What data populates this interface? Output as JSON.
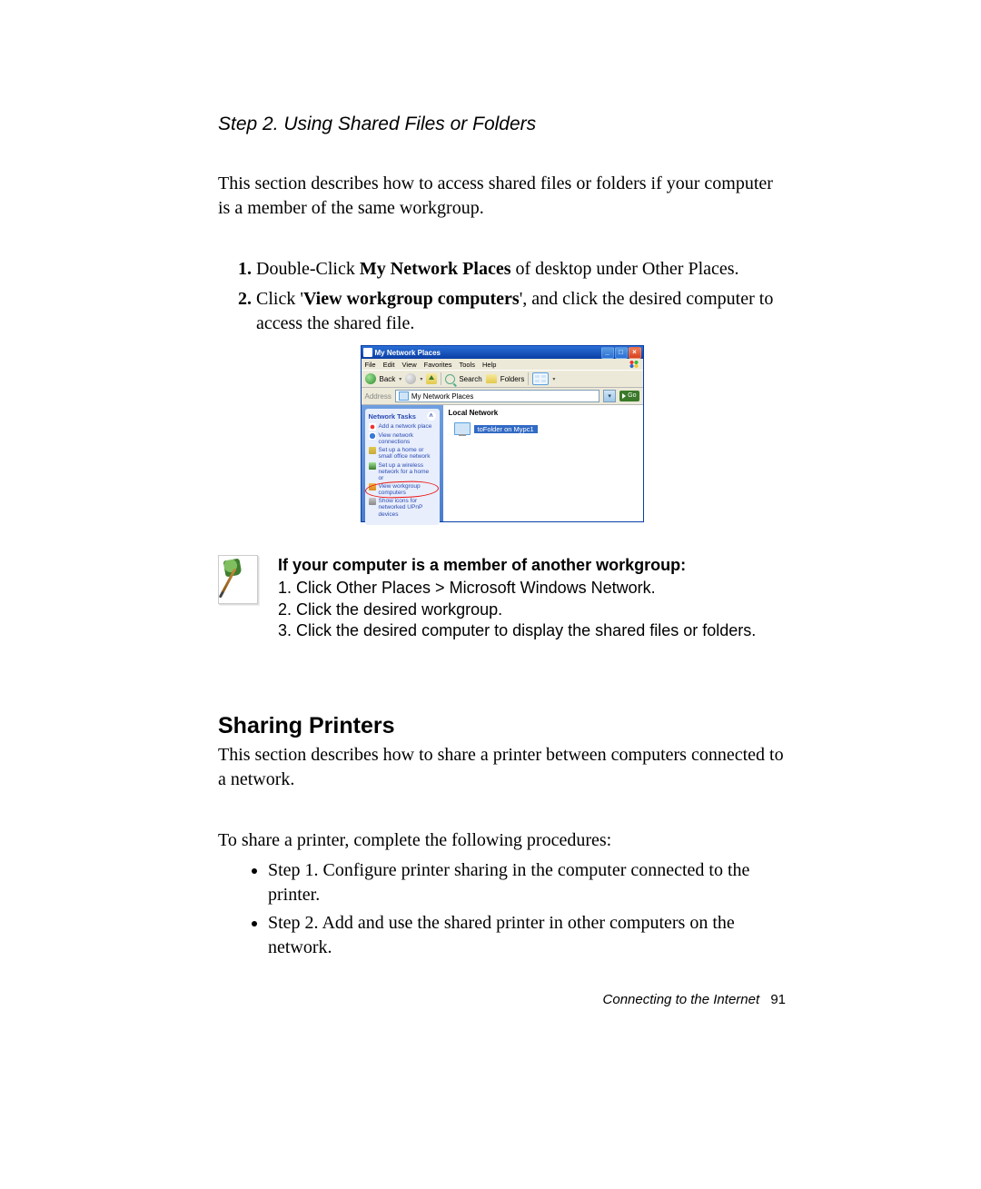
{
  "step_title": "Step 2. Using Shared Files or Folders",
  "intro": "This section describes how to access shared files or folders if your computer is a member of the same workgroup.",
  "steps": {
    "s1_a": "Double-Click ",
    "s1_b": "My Network Places",
    "s1_c": " of desktop under Other Places.",
    "s2_a": "Click '",
    "s2_b": "View workgroup computers",
    "s2_c": "', and click the desired computer to access the shared file."
  },
  "xp": {
    "title": "My Network Places",
    "menus": [
      "File",
      "Edit",
      "View",
      "Favorites",
      "Tools",
      "Help"
    ],
    "toolbar": {
      "back": "Back",
      "search": "Search",
      "folders": "Folders"
    },
    "addr_label": "Address",
    "addr_value": "My Network Places",
    "go": "Go",
    "tasks_header": "Network Tasks",
    "tasks": [
      "Add a network place",
      "View network connections",
      "Set up a home or small office network",
      "Set up a wireless network for a home or",
      "View workgroup computers",
      "Show icons for networked UPnP devices"
    ],
    "main_header": "Local Network",
    "item_label": "toFolder on Mypc1"
  },
  "note": {
    "title": "If your computer is a member of another workgroup:",
    "l1": "1. Click Other Places > Microsoft Windows Network.",
    "l2": "2. Click the desired workgroup.",
    "l3": "3. Click the desired computer to display the shared files or folders."
  },
  "printers": {
    "heading": "Sharing Printers",
    "intro": "This section describes how to share a printer between computers connected to a network.",
    "lead": "To share a printer, complete the following procedures:",
    "b1": "Step 1. Configure printer sharing in the computer connected to the printer.",
    "b2": "Step 2. Add and use the shared printer in other computers on the network."
  },
  "footer": {
    "text": "Connecting to the Internet",
    "page": "91"
  }
}
